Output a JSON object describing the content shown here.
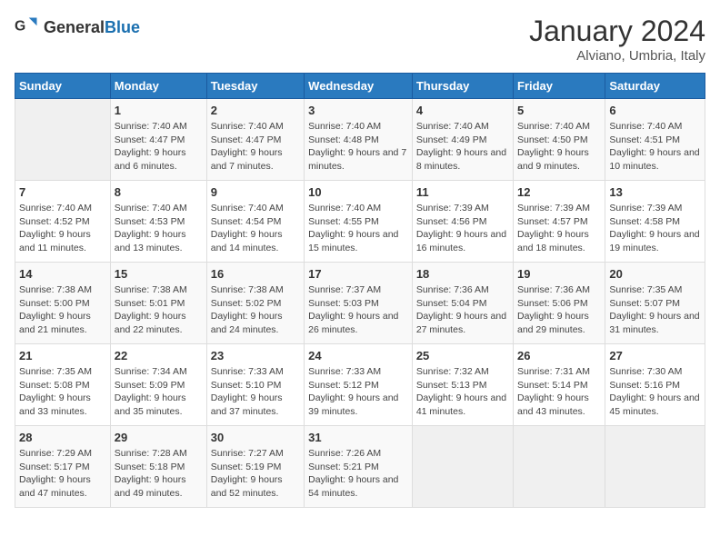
{
  "logo": {
    "general": "General",
    "blue": "Blue"
  },
  "header": {
    "title": "January 2024",
    "subtitle": "Alviano, Umbria, Italy"
  },
  "weekdays": [
    "Sunday",
    "Monday",
    "Tuesday",
    "Wednesday",
    "Thursday",
    "Friday",
    "Saturday"
  ],
  "weeks": [
    [
      {
        "day": "",
        "empty": true
      },
      {
        "day": "1",
        "sunrise": "Sunrise: 7:40 AM",
        "sunset": "Sunset: 4:47 PM",
        "daylight": "Daylight: 9 hours and 6 minutes."
      },
      {
        "day": "2",
        "sunrise": "Sunrise: 7:40 AM",
        "sunset": "Sunset: 4:47 PM",
        "daylight": "Daylight: 9 hours and 7 minutes."
      },
      {
        "day": "3",
        "sunrise": "Sunrise: 7:40 AM",
        "sunset": "Sunset: 4:48 PM",
        "daylight": "Daylight: 9 hours and 7 minutes."
      },
      {
        "day": "4",
        "sunrise": "Sunrise: 7:40 AM",
        "sunset": "Sunset: 4:49 PM",
        "daylight": "Daylight: 9 hours and 8 minutes."
      },
      {
        "day": "5",
        "sunrise": "Sunrise: 7:40 AM",
        "sunset": "Sunset: 4:50 PM",
        "daylight": "Daylight: 9 hours and 9 minutes."
      },
      {
        "day": "6",
        "sunrise": "Sunrise: 7:40 AM",
        "sunset": "Sunset: 4:51 PM",
        "daylight": "Daylight: 9 hours and 10 minutes."
      }
    ],
    [
      {
        "day": "7",
        "sunrise": "Sunrise: 7:40 AM",
        "sunset": "Sunset: 4:52 PM",
        "daylight": "Daylight: 9 hours and 11 minutes."
      },
      {
        "day": "8",
        "sunrise": "Sunrise: 7:40 AM",
        "sunset": "Sunset: 4:53 PM",
        "daylight": "Daylight: 9 hours and 13 minutes."
      },
      {
        "day": "9",
        "sunrise": "Sunrise: 7:40 AM",
        "sunset": "Sunset: 4:54 PM",
        "daylight": "Daylight: 9 hours and 14 minutes."
      },
      {
        "day": "10",
        "sunrise": "Sunrise: 7:40 AM",
        "sunset": "Sunset: 4:55 PM",
        "daylight": "Daylight: 9 hours and 15 minutes."
      },
      {
        "day": "11",
        "sunrise": "Sunrise: 7:39 AM",
        "sunset": "Sunset: 4:56 PM",
        "daylight": "Daylight: 9 hours and 16 minutes."
      },
      {
        "day": "12",
        "sunrise": "Sunrise: 7:39 AM",
        "sunset": "Sunset: 4:57 PM",
        "daylight": "Daylight: 9 hours and 18 minutes."
      },
      {
        "day": "13",
        "sunrise": "Sunrise: 7:39 AM",
        "sunset": "Sunset: 4:58 PM",
        "daylight": "Daylight: 9 hours and 19 minutes."
      }
    ],
    [
      {
        "day": "14",
        "sunrise": "Sunrise: 7:38 AM",
        "sunset": "Sunset: 5:00 PM",
        "daylight": "Daylight: 9 hours and 21 minutes."
      },
      {
        "day": "15",
        "sunrise": "Sunrise: 7:38 AM",
        "sunset": "Sunset: 5:01 PM",
        "daylight": "Daylight: 9 hours and 22 minutes."
      },
      {
        "day": "16",
        "sunrise": "Sunrise: 7:38 AM",
        "sunset": "Sunset: 5:02 PM",
        "daylight": "Daylight: 9 hours and 24 minutes."
      },
      {
        "day": "17",
        "sunrise": "Sunrise: 7:37 AM",
        "sunset": "Sunset: 5:03 PM",
        "daylight": "Daylight: 9 hours and 26 minutes."
      },
      {
        "day": "18",
        "sunrise": "Sunrise: 7:36 AM",
        "sunset": "Sunset: 5:04 PM",
        "daylight": "Daylight: 9 hours and 27 minutes."
      },
      {
        "day": "19",
        "sunrise": "Sunrise: 7:36 AM",
        "sunset": "Sunset: 5:06 PM",
        "daylight": "Daylight: 9 hours and 29 minutes."
      },
      {
        "day": "20",
        "sunrise": "Sunrise: 7:35 AM",
        "sunset": "Sunset: 5:07 PM",
        "daylight": "Daylight: 9 hours and 31 minutes."
      }
    ],
    [
      {
        "day": "21",
        "sunrise": "Sunrise: 7:35 AM",
        "sunset": "Sunset: 5:08 PM",
        "daylight": "Daylight: 9 hours and 33 minutes."
      },
      {
        "day": "22",
        "sunrise": "Sunrise: 7:34 AM",
        "sunset": "Sunset: 5:09 PM",
        "daylight": "Daylight: 9 hours and 35 minutes."
      },
      {
        "day": "23",
        "sunrise": "Sunrise: 7:33 AM",
        "sunset": "Sunset: 5:10 PM",
        "daylight": "Daylight: 9 hours and 37 minutes."
      },
      {
        "day": "24",
        "sunrise": "Sunrise: 7:33 AM",
        "sunset": "Sunset: 5:12 PM",
        "daylight": "Daylight: 9 hours and 39 minutes."
      },
      {
        "day": "25",
        "sunrise": "Sunrise: 7:32 AM",
        "sunset": "Sunset: 5:13 PM",
        "daylight": "Daylight: 9 hours and 41 minutes."
      },
      {
        "day": "26",
        "sunrise": "Sunrise: 7:31 AM",
        "sunset": "Sunset: 5:14 PM",
        "daylight": "Daylight: 9 hours and 43 minutes."
      },
      {
        "day": "27",
        "sunrise": "Sunrise: 7:30 AM",
        "sunset": "Sunset: 5:16 PM",
        "daylight": "Daylight: 9 hours and 45 minutes."
      }
    ],
    [
      {
        "day": "28",
        "sunrise": "Sunrise: 7:29 AM",
        "sunset": "Sunset: 5:17 PM",
        "daylight": "Daylight: 9 hours and 47 minutes."
      },
      {
        "day": "29",
        "sunrise": "Sunrise: 7:28 AM",
        "sunset": "Sunset: 5:18 PM",
        "daylight": "Daylight: 9 hours and 49 minutes."
      },
      {
        "day": "30",
        "sunrise": "Sunrise: 7:27 AM",
        "sunset": "Sunset: 5:19 PM",
        "daylight": "Daylight: 9 hours and 52 minutes."
      },
      {
        "day": "31",
        "sunrise": "Sunrise: 7:26 AM",
        "sunset": "Sunset: 5:21 PM",
        "daylight": "Daylight: 9 hours and 54 minutes."
      },
      {
        "day": "",
        "empty": true
      },
      {
        "day": "",
        "empty": true
      },
      {
        "day": "",
        "empty": true
      }
    ]
  ]
}
